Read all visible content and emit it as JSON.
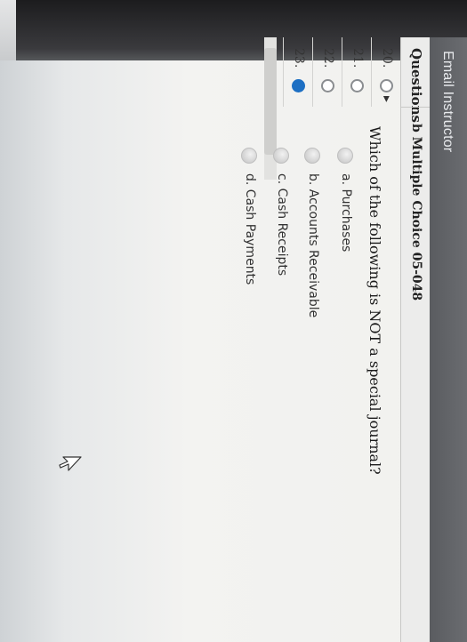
{
  "header": {
    "email_instructor": "Email Instructor"
  },
  "columns": {
    "questions": "Questions",
    "problem_title": "b Multiple Choice 05-048"
  },
  "questions": [
    {
      "number": "20.",
      "status": "unanswered",
      "current": true
    },
    {
      "number": "21.",
      "status": "unanswered",
      "current": false
    },
    {
      "number": "22.",
      "status": "unanswered",
      "current": false
    },
    {
      "number": "23.",
      "status": "answered",
      "current": false
    }
  ],
  "question": {
    "text": "Which of the following is NOT a special journal?",
    "choices": [
      {
        "label": "a. Purchases"
      },
      {
        "label": "b. Accounts Receivable"
      },
      {
        "label": "c. Cash Receipts"
      },
      {
        "label": "d. Cash Payments"
      }
    ]
  },
  "colors": {
    "header_bar": "#5a5c60",
    "answered_status": "#1d6fc3"
  }
}
